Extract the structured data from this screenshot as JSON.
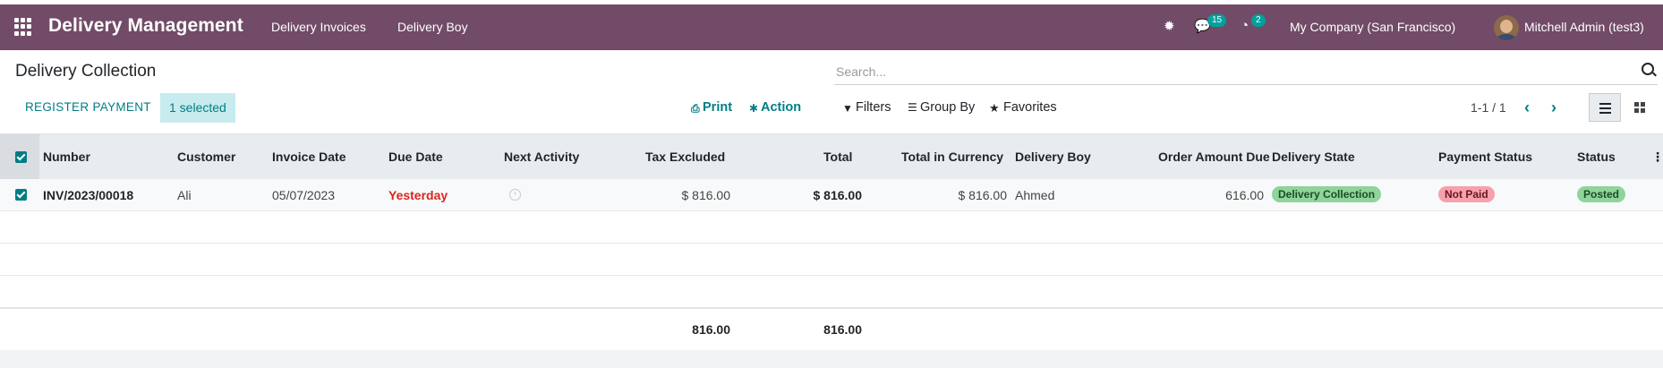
{
  "navbar": {
    "app_title": "Delivery Management",
    "menu": [
      "Delivery Invoices",
      "Delivery Boy"
    ],
    "messages_count": "15",
    "activities_count": "2",
    "company": "My Company (San Francisco)",
    "user": "Mitchell Admin (test3)"
  },
  "control_panel": {
    "title": "Delivery Collection",
    "search_placeholder": "Search...",
    "register_payment": "REGISTER PAYMENT",
    "selected": "1 selected",
    "print": "Print",
    "action": "Action",
    "filters": "Filters",
    "group_by": "Group By",
    "favorites": "Favorites",
    "pager": "1-1 / 1"
  },
  "table": {
    "columns": [
      "Number",
      "Customer",
      "Invoice Date",
      "Due Date",
      "Next Activity",
      "Tax Excluded",
      "Total",
      "Total in Currency",
      "Delivery Boy",
      "Order Amount Due",
      "Delivery State",
      "Payment Status",
      "Status"
    ],
    "rows": [
      {
        "number": "INV/2023/00018",
        "customer": "Ali",
        "invoice_date": "05/07/2023",
        "due_date": "Yesterday",
        "tax_excluded": "$ 816.00",
        "total": "$ 816.00",
        "total_currency": "$ 816.00",
        "delivery_boy": "Ahmed",
        "order_amount_due": "616.00",
        "delivery_state": "Delivery Collection",
        "payment_status": "Not Paid",
        "status": "Posted"
      }
    ],
    "totals": {
      "tax_excluded": "816.00",
      "total": "816.00"
    }
  },
  "colors": {
    "navbar": "#714B67",
    "accent": "#017E84",
    "due_overdue": "#d9251d",
    "delivery_state_pill": "#8ed49b",
    "payment_pill": "#f6a1ab",
    "posted_pill": "#8ed49b"
  }
}
